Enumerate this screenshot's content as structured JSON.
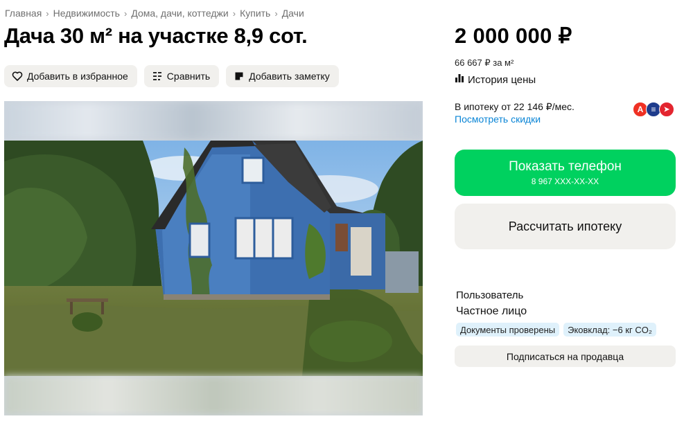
{
  "breadcrumb": [
    "Главная",
    "Недвижимость",
    "Дома, дачи, коттеджи",
    "Купить",
    "Дачи"
  ],
  "breadcrumb_separator": "›",
  "title": "Дача 30 м² на участке 8,9 сот.",
  "actions": {
    "favorite": "Добавить в избранное",
    "compare": "Сравнить",
    "note": "Добавить заметку"
  },
  "price": {
    "value": "2 000 000 ₽",
    "per_meter": "66 667 ₽ за м²",
    "history": "История цены"
  },
  "mortgage": {
    "text": "В ипотеку от 22 146 ₽/мес.",
    "discounts": "Посмотреть скидки",
    "banks": [
      {
        "icon": "alfa-bank-icon",
        "letter": "А",
        "color": "#ef3124"
      },
      {
        "icon": "bank-stripes-icon",
        "letter": "≡",
        "color": "#1e3c8c"
      },
      {
        "icon": "bank-arrow-icon",
        "letter": "➤",
        "color": "#e3252f"
      }
    ]
  },
  "buttons": {
    "show_phone": "Показать телефон",
    "phone_masked": "8 967 XXX-XX-XX",
    "calc_mortgage": "Рассчитать ипотеку",
    "subscribe": "Подписаться на продавца"
  },
  "seller": {
    "role": "Пользователь",
    "type": "Частное лицо",
    "badges": [
      "Документы проверены",
      "Эковклад: −6 кг CO₂"
    ]
  },
  "colors": {
    "accent_green": "#00d15f",
    "link_blue": "#0a85d6",
    "button_bg": "#f1f0ed",
    "badge_bg": "#dff1fb"
  },
  "icons": [
    "heart-icon",
    "compare-icon",
    "note-icon",
    "chart-icon"
  ]
}
